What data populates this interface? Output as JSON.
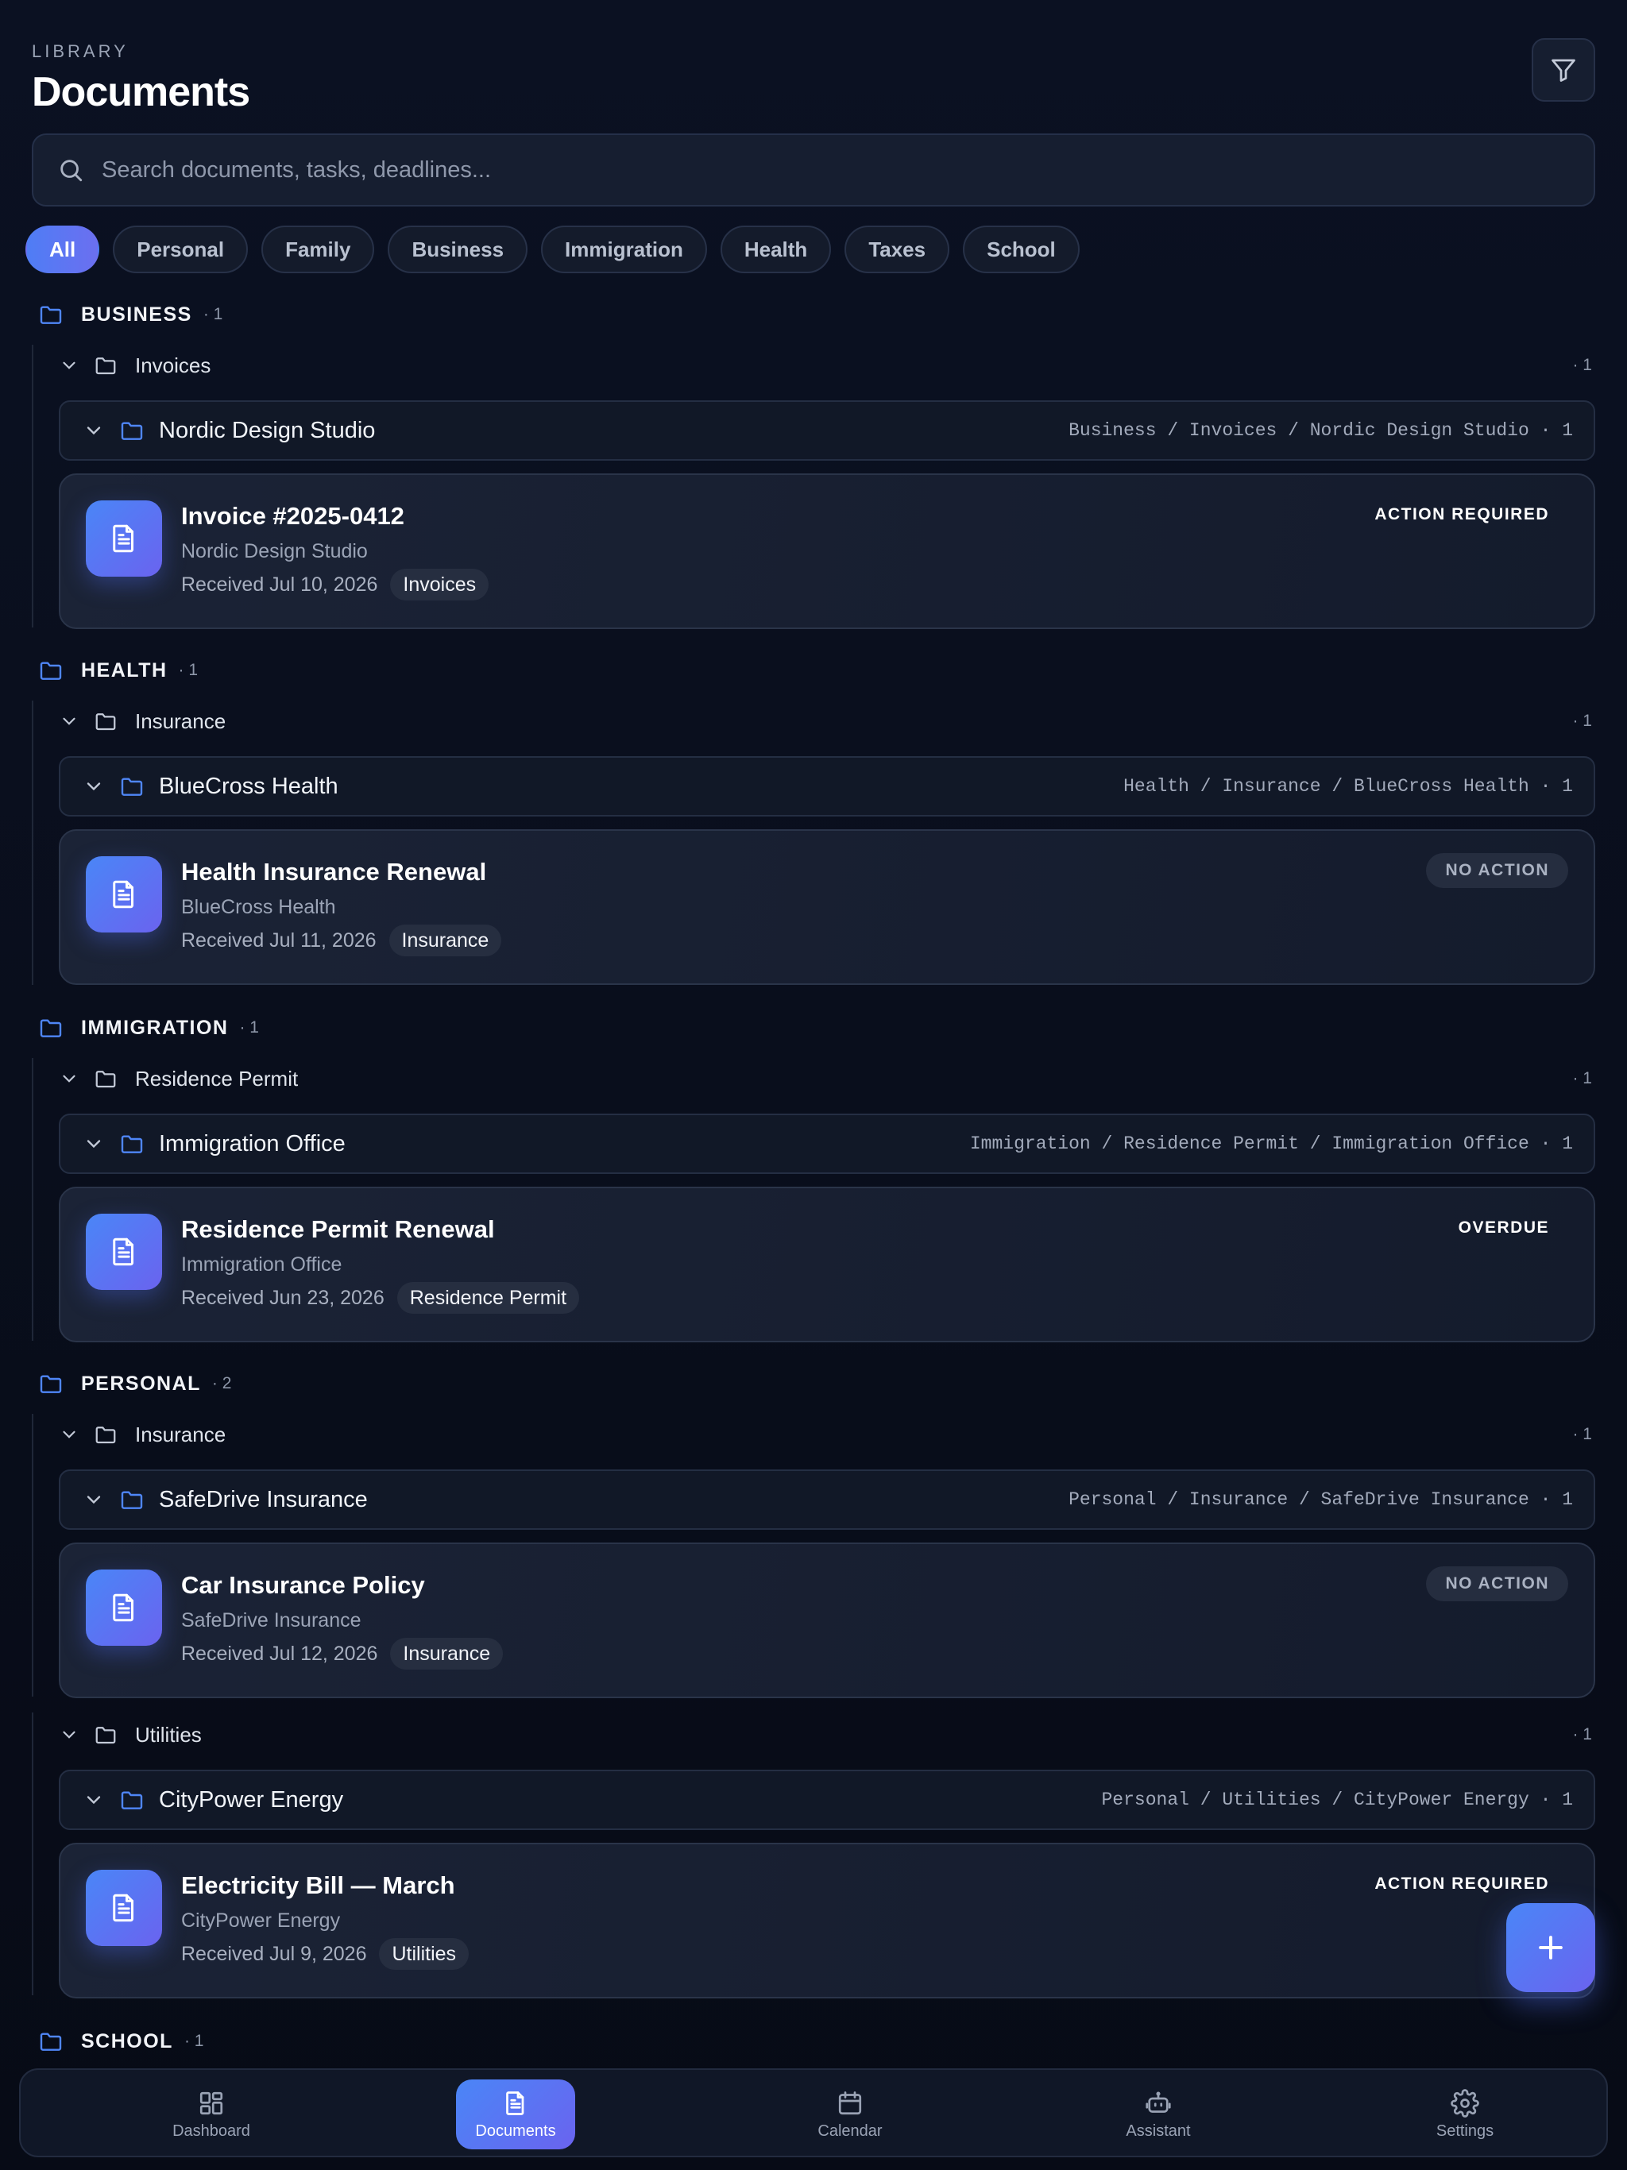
{
  "header": {
    "eyebrow": "LIBRARY",
    "title": "Documents"
  },
  "search": {
    "placeholder": "Search documents, tasks, deadlines..."
  },
  "chips": [
    "All",
    "Personal",
    "Family",
    "Business",
    "Immigration",
    "Health",
    "Taxes",
    "School"
  ],
  "active_chip": "All",
  "sections": [
    {
      "name": "BUSINESS",
      "count": "· 1",
      "groups": [
        {
          "name": "Invoices",
          "count": "· 1",
          "vendor": "Nordic Design Studio",
          "path": "Business / Invoices / Nordic Design Studio · 1",
          "doc": {
            "title": "Invoice #2025-0412",
            "vendor": "Nordic Design Studio",
            "date": "Received Jul 10, 2026",
            "tag": "Invoices",
            "status": "ACTION REQUIRED"
          }
        }
      ]
    },
    {
      "name": "HEALTH",
      "count": "· 1",
      "groups": [
        {
          "name": "Insurance",
          "count": "· 1",
          "vendor": "BlueCross Health",
          "path": "Health / Insurance / BlueCross Health · 1",
          "doc": {
            "title": "Health Insurance Renewal",
            "vendor": "BlueCross Health",
            "date": "Received Jul 11, 2026",
            "tag": "Insurance",
            "status": "NO ACTION"
          }
        }
      ]
    },
    {
      "name": "IMMIGRATION",
      "count": "· 1",
      "groups": [
        {
          "name": "Residence Permit",
          "count": "· 1",
          "vendor": "Immigration Office",
          "path": "Immigration / Residence Permit / Immigration Office · 1",
          "doc": {
            "title": "Residence Permit Renewal",
            "vendor": "Immigration Office",
            "date": "Received Jun 23, 2026",
            "tag": "Residence Permit",
            "status": "OVERDUE"
          }
        }
      ]
    },
    {
      "name": "PERSONAL",
      "count": "· 2",
      "groups": [
        {
          "name": "Insurance",
          "count": "· 1",
          "vendor": "SafeDrive Insurance",
          "path": "Personal / Insurance / SafeDrive Insurance · 1",
          "doc": {
            "title": "Car Insurance Policy",
            "vendor": "SafeDrive Insurance",
            "date": "Received Jul 12, 2026",
            "tag": "Insurance",
            "status": "NO ACTION"
          }
        },
        {
          "name": "Utilities",
          "count": "· 1",
          "vendor": "CityPower Energy",
          "path": "Personal / Utilities / CityPower Energy · 1",
          "doc": {
            "title": "Electricity Bill — March",
            "vendor": "CityPower Energy",
            "date": "Received Jul 9, 2026",
            "tag": "Utilities",
            "status": "ACTION REQUIRED"
          }
        }
      ]
    },
    {
      "name": "SCHOOL",
      "count": "· 1",
      "groups": []
    }
  ],
  "nav": [
    {
      "label": "Dashboard",
      "icon": "grid-icon"
    },
    {
      "label": "Documents",
      "icon": "document-icon"
    },
    {
      "label": "Calendar",
      "icon": "calendar-icon"
    },
    {
      "label": "Assistant",
      "icon": "robot-icon"
    },
    {
      "label": "Settings",
      "icon": "gear-icon"
    }
  ],
  "active_nav": "Documents",
  "colors": {
    "accent": "#4f7df5",
    "accent_end": "#6a63ef",
    "background": "#080d1a",
    "folder_blue": "#4f86f7"
  }
}
